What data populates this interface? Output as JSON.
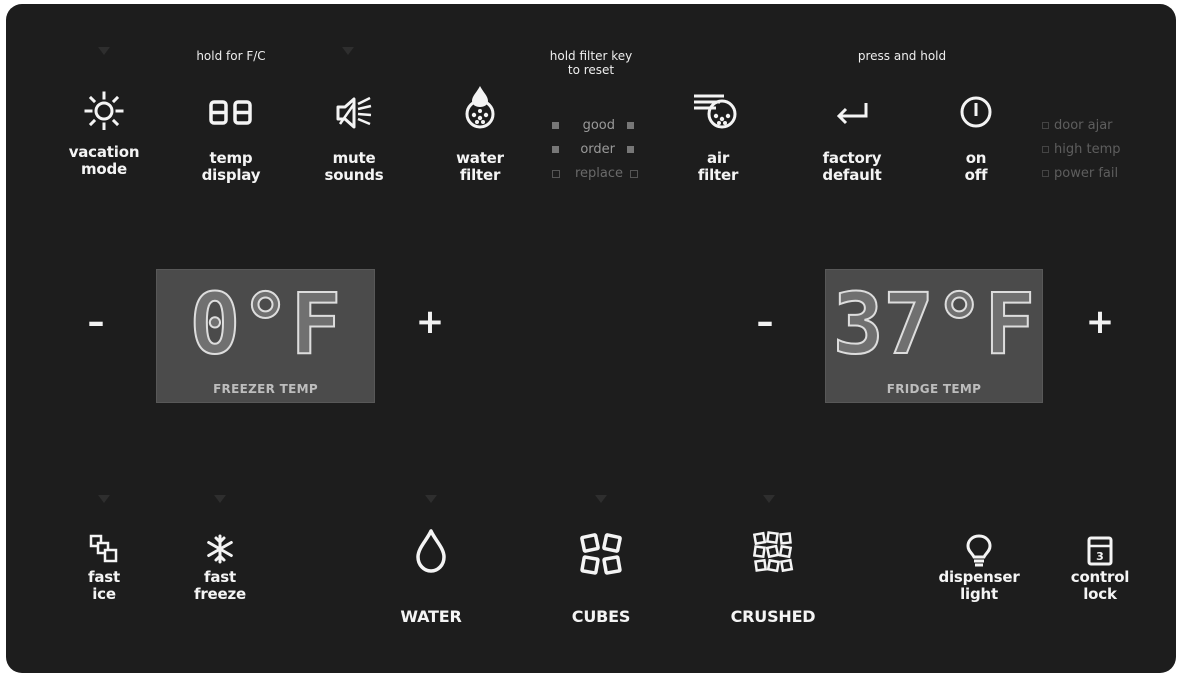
{
  "hints": {
    "temp_display": "hold for F/C",
    "filter_reset": [
      "hold filter key",
      "to reset"
    ],
    "press_hold": "press and hold"
  },
  "top_buttons": [
    {
      "key": "vacation",
      "line1": "vacation",
      "line2": "mode",
      "icon": "sun-icon"
    },
    {
      "key": "temp",
      "line1": "temp",
      "line2": "display",
      "icon": "segment-display-icon"
    },
    {
      "key": "mute",
      "line1": "mute",
      "line2": "sounds",
      "icon": "speaker-mute-icon"
    },
    {
      "key": "water_filter",
      "line1": "water",
      "line2": "filter",
      "icon": "water-filter-icon"
    },
    {
      "key": "air_filter",
      "line1": "air",
      "line2": "filter",
      "icon": "air-filter-icon"
    },
    {
      "key": "factory",
      "line1": "factory",
      "line2": "default",
      "icon": "return-arrow-icon"
    },
    {
      "key": "power",
      "line1": "on",
      "line2": "off",
      "icon": "power-icon"
    }
  ],
  "filter_status": [
    "good",
    "order",
    "replace"
  ],
  "alerts": [
    "door ajar",
    "high temp",
    "power fail"
  ],
  "freezer": {
    "value": "0°F",
    "label": "FREEZER TEMP",
    "minus": "–",
    "plus": "+"
  },
  "fridge": {
    "value": "37°F",
    "label": "FRIDGE TEMP",
    "minus": "–",
    "plus": "+"
  },
  "bottom_buttons": [
    {
      "key": "fast_ice",
      "line1": "fast",
      "line2": "ice",
      "icon": "stacked-squares-icon"
    },
    {
      "key": "fast_freeze",
      "line1": "fast",
      "line2": "freeze",
      "icon": "snowflake-icon"
    },
    {
      "key": "water",
      "line1": "WATER",
      "icon": "water-drop-icon"
    },
    {
      "key": "cubes",
      "line1": "CUBES",
      "icon": "ice-cubes-icon"
    },
    {
      "key": "crushed",
      "line1": "CRUSHED",
      "icon": "crushed-ice-icon"
    },
    {
      "key": "light",
      "line1": "dispenser",
      "line2": "light",
      "icon": "light-bulb-icon"
    },
    {
      "key": "lock",
      "line1": "control",
      "line2": "lock",
      "icon": "lock-icon",
      "badge": "3"
    }
  ],
  "colors": {
    "panel": "#1d1d1d",
    "text": "#f4f4f4",
    "lcd": "#4b4b4b"
  }
}
